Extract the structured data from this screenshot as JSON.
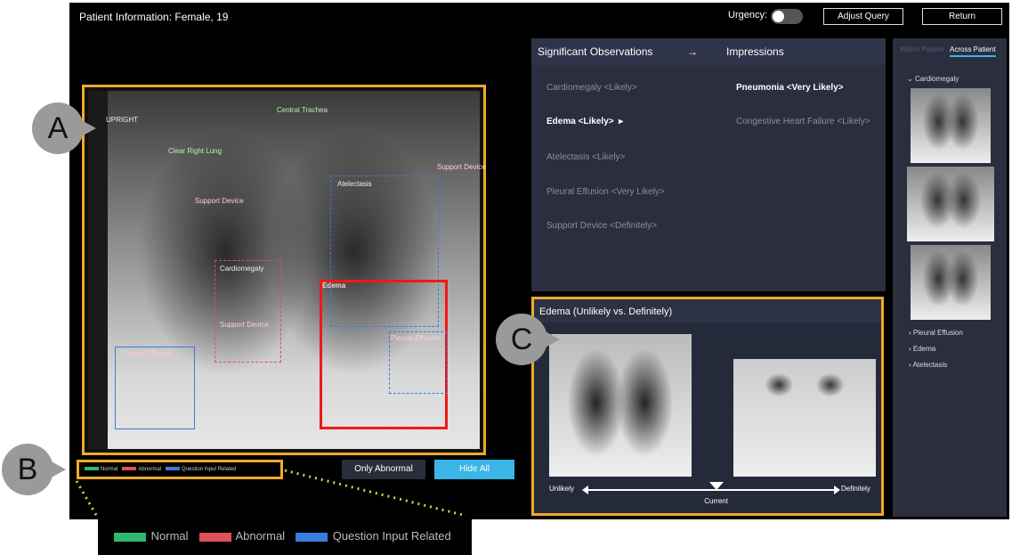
{
  "header": {
    "title": "Patient Information: Female, 19",
    "urgency_label": "Urgency:",
    "urgency_on": false,
    "adjust_query": "Adjust Query",
    "return": "Return"
  },
  "xray": {
    "labels": {
      "upright": "UPRIGHT",
      "central_trachea": "Central Trachea",
      "clear_right_lung": "Clear Right Lung",
      "support_device_1": "Support Device",
      "support_device_2": "Support Device",
      "support_device_3": "Support Device",
      "atelectasis": "Atelectasis",
      "cardiomegaly": "Cardiomegaly",
      "edema": "Edema",
      "pleural_effusion_1": "Pleural Effusion",
      "pleural_effusion_2": "Pleural Effusion"
    }
  },
  "legend": {
    "normal": "Normal",
    "abnormal": "Abnormal",
    "question": "Question Input Related",
    "colors": {
      "normal": "#2fb86e",
      "abnormal": "#e0505c",
      "question": "#3a7be0"
    }
  },
  "buttons": {
    "only_abnormal": "Only Abnormal",
    "hide_all": "Hide All"
  },
  "observations": {
    "header": "Significant Observations",
    "arrow": "→",
    "impressions_header": "Impressions",
    "items": [
      "Cardiomegaly <Likely>",
      "Edema <Likely>",
      "Atelectasis <Likely>",
      "Pleural Effusion <Very Likely>",
      "Support Device <Definitely>"
    ],
    "impressions": [
      "Pneumonia <Very Likely>",
      "Congestive Heart Failure <Likely>"
    ]
  },
  "detail": {
    "title": "Edema (Unlikely vs. Definitely)",
    "left": "Unlikely",
    "right": "Definitely",
    "current": "Current",
    "current_position": 0.52
  },
  "sidebar": {
    "tab_within": "Within Patient",
    "tab_across": "Across Patient",
    "expanded": "Cardiomegaly",
    "collapsed": [
      "Pleural Effusion",
      "Edema",
      "Atelectasis"
    ]
  },
  "callouts": {
    "a": "A",
    "b": "B",
    "c": "C"
  }
}
